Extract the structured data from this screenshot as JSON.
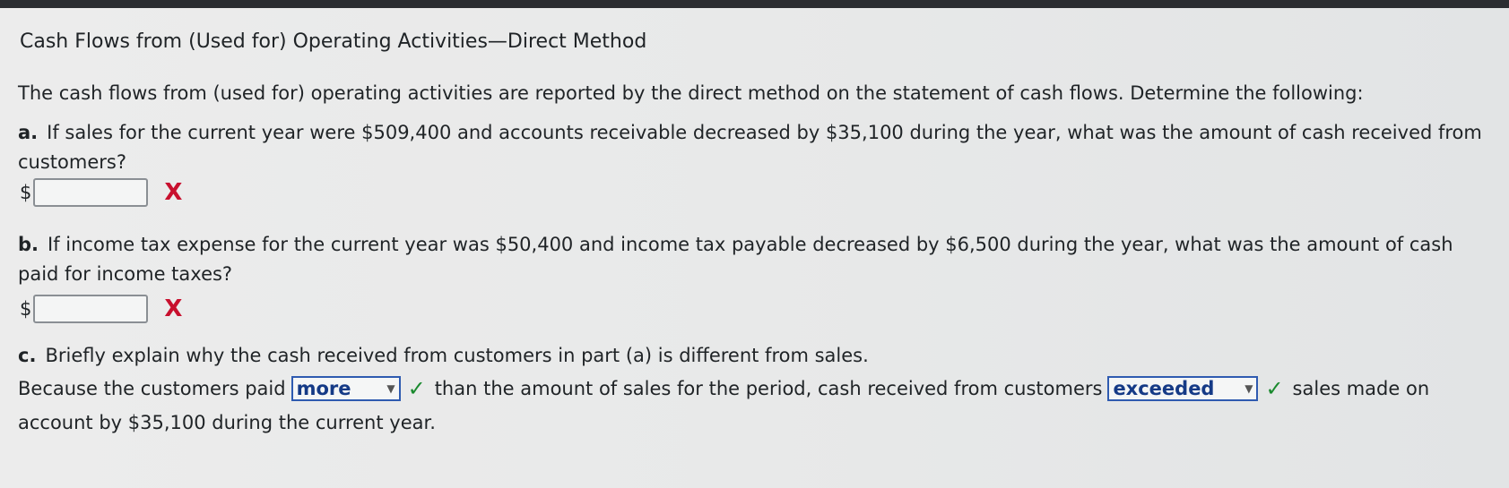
{
  "title": "Cash Flows from (Used for) Operating Activities—Direct Method",
  "intro": "The cash flows from (used for) operating activities are reported by the direct method on the statement of cash flows. Determine the following:",
  "part_a": {
    "letter": "a.",
    "text_line1": "If sales for the current year were $509,400 and accounts receivable decreased by $35,100 during the year, what was the amount of cash received from",
    "text_line2": "customers?",
    "currency": "$",
    "value": "",
    "result_mark": "X"
  },
  "part_b": {
    "letter": "b.",
    "text_line1": "If income tax expense for the current year was $50,400 and income tax payable decreased by $6,500 during the year, what was the amount of cash",
    "text_line2": "paid for income taxes?",
    "currency": "$",
    "value": "",
    "result_mark": "X"
  },
  "part_c": {
    "letter": "c.",
    "question": "Briefly explain why the cash received from customers in part (a) is different from sales.",
    "sentence_start": "Because the customers paid",
    "select1_value": "more",
    "sentence_mid": "than the amount of sales for the period, cash received from customers",
    "select2_value": "exceeded",
    "sentence_end1": "sales made on",
    "sentence_end2": "account by $35,100 during the current year.",
    "check_mark": "✓"
  }
}
